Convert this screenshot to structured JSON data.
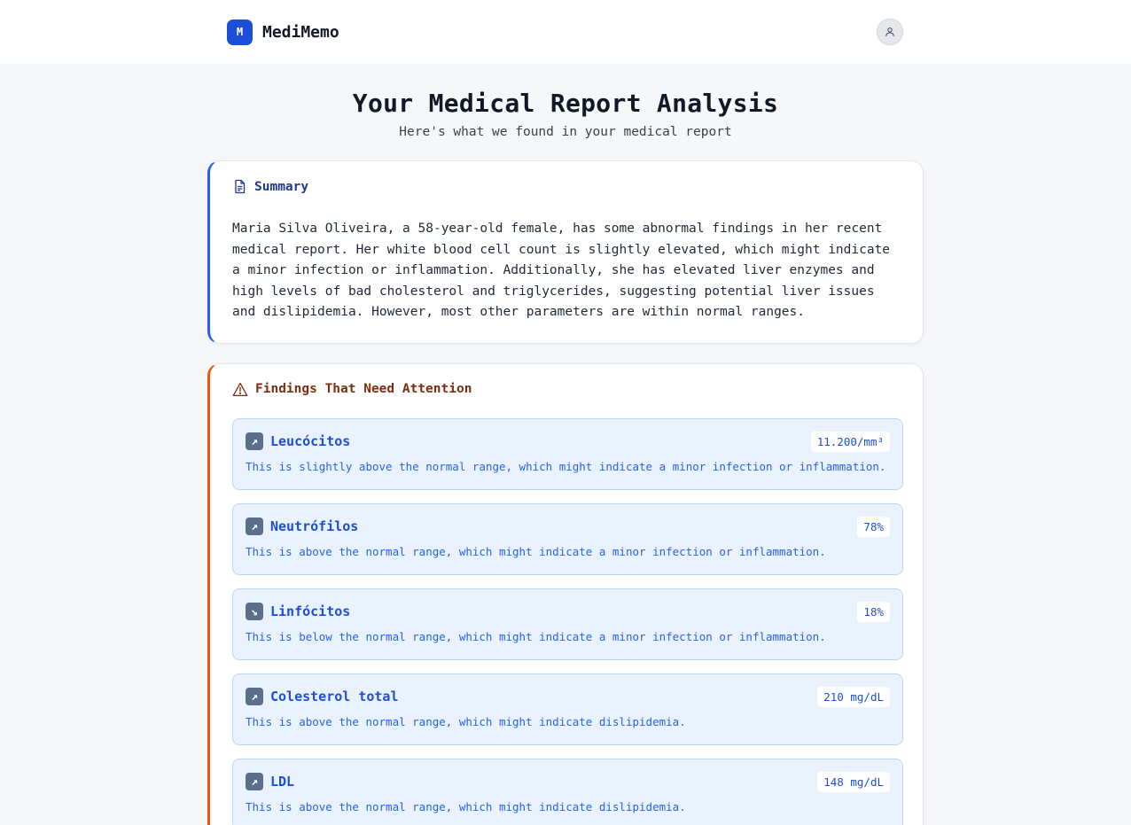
{
  "header": {
    "logo_letter": "M",
    "brand": "MediMemo"
  },
  "page": {
    "title": "Your Medical Report Analysis",
    "subtitle": "Here's what we found in your medical report"
  },
  "summary": {
    "title": "Summary",
    "text": "Maria Silva Oliveira, a 58-year-old female, has some abnormal findings in her recent medical report. Her white blood cell count is slightly elevated, which might indicate a minor infection or inflammation. Additionally, she has elevated liver enzymes and high levels of bad cholesterol and triglycerides, suggesting potential liver issues and dislipidemia. However, most other parameters are within normal ranges."
  },
  "findings": {
    "title": "Findings That Need Attention",
    "items": [
      {
        "trend": "up",
        "icon": "arrow-up-right-icon",
        "name": "Leucócitos",
        "value": "11.200/mm³",
        "description": "This is slightly above the normal range, which might indicate a minor infection or inflammation."
      },
      {
        "trend": "up",
        "icon": "arrow-up-right-icon",
        "name": "Neutrófilos",
        "value": "78%",
        "description": "This is above the normal range, which might indicate a minor infection or inflammation."
      },
      {
        "trend": "down",
        "icon": "arrow-down-right-icon",
        "name": "Linfócitos",
        "value": "18%",
        "description": "This is below the normal range, which might indicate a minor infection or inflammation."
      },
      {
        "trend": "up",
        "icon": "arrow-up-right-icon",
        "name": "Colesterol total",
        "value": "210 mg/dL",
        "description": "This is above the normal range, which might indicate dislipidemia."
      },
      {
        "trend": "up",
        "icon": "arrow-up-right-icon",
        "name": "LDL",
        "value": "148 mg/dL",
        "description": "This is above the normal range, which might indicate dislipidemia."
      }
    ]
  },
  "colors": {
    "brand": "#1d4ed8",
    "summary_accent": "#2563eb",
    "findings_accent": "#ea580c",
    "finding_bg": "#eaf2fd"
  }
}
